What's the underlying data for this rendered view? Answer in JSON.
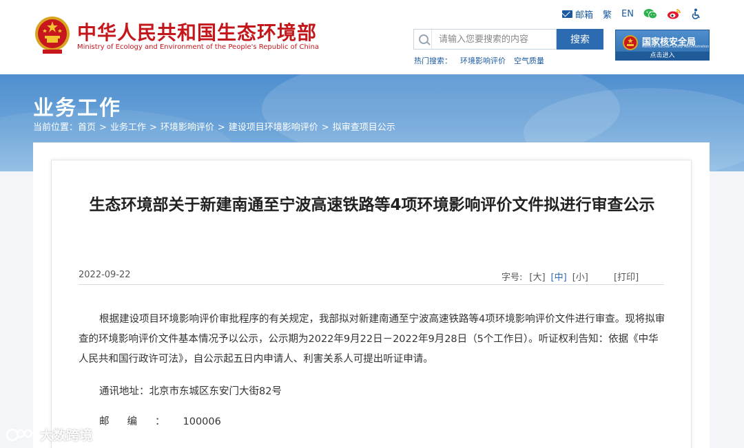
{
  "header": {
    "title_cn": "中华人民共和国生态环境部",
    "title_en": "Ministry of Ecology and Environment of the People's Republic of China",
    "top_links": [
      {
        "label": "邮箱",
        "icon": "mail-icon"
      },
      {
        "label": "繁"
      },
      {
        "label": "EN"
      },
      {
        "icon": "wechat-icon"
      },
      {
        "icon": "weibo-icon"
      },
      {
        "icon": "accessibility-icon"
      }
    ],
    "search": {
      "placeholder": "请输入您要搜索的内容",
      "button_label": "搜索",
      "hot_label": "热门搜索：",
      "hot_terms": [
        "环境影响评价",
        "空气质量"
      ]
    },
    "nsa": {
      "title": "国家核安全局",
      "subtitle": "National Nuclear Safety Administration",
      "enter": "点击进入"
    }
  },
  "banner": {
    "section_title": "业务工作",
    "breadcrumb_prefix": "当前位置：",
    "breadcrumb": [
      "首页",
      "业务工作",
      "环境影响评价",
      "建设项目环境影响评价",
      "拟审查项目公示"
    ],
    "separator": ">"
  },
  "article": {
    "title": "生态环境部关于新建南通至宁波高速铁路等4项环境影响评价文件拟进行审查公示",
    "date": "2022-09-22",
    "font_size_label": "字号:",
    "font_options": [
      "[大]",
      "[中]",
      "[小]"
    ],
    "active_font_option": "[中]",
    "print_label": "[打印]",
    "paragraph": "根据建设项目环境影响评价审批程序的有关规定，我部拟对新建南通至宁波高速铁路等4项环境影响评价文件进行审查。现将拟审查的环境影响评价文件基本情况予以公示，公示期为2022年9月22日－2022年9月28日（5个工作日）。听证权利告知：依据《中华人民共和国行政许可法》，自公示起五日内申请人、利害关系人可提出听证申请。",
    "address_label": "通讯地址：",
    "address_value": "北京市东城区东安门大街82号",
    "postcode_label": "邮编：",
    "postcode_value": "100006"
  },
  "watermark": {
    "text": "大数跨境"
  },
  "colors": {
    "brand_red": "#c4171c",
    "link_blue": "#1a5a9e",
    "button_blue": "#2c6bb0",
    "wechat_green": "#2bb24c",
    "weibo_red": "#e6162d"
  }
}
